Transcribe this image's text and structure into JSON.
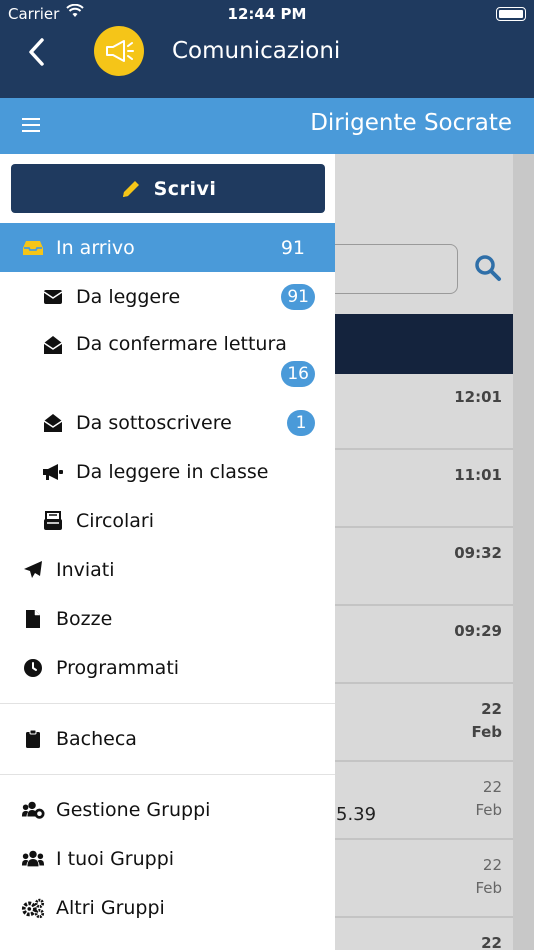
{
  "status_bar": {
    "carrier": "Carrier",
    "time": "12:44 PM"
  },
  "header": {
    "title": "Comunicazioni",
    "user": "Dirigente Socrate"
  },
  "colors": {
    "primary": "#1f3a5f",
    "accent": "#4a9ad9",
    "brand_icon": "#f5c518"
  },
  "drawer": {
    "compose_label": "Scrivi",
    "inbox": {
      "label": "In arrivo",
      "count": "91"
    },
    "inbox_sub": {
      "to_read": {
        "label": "Da leggere",
        "badge": "91"
      },
      "to_confirm": {
        "label": "Da confermare lettura",
        "badge": "16"
      },
      "to_sign": {
        "label": "Da sottoscrivere",
        "badge": "1"
      },
      "read_in_class": {
        "label": "Da leggere in classe"
      },
      "circulars": {
        "label": "Circolari"
      }
    },
    "sent": {
      "label": "Inviati"
    },
    "drafts": {
      "label": "Bozze"
    },
    "scheduled": {
      "label": "Programmati"
    },
    "board": {
      "label": "Bacheca"
    },
    "groups_manage": {
      "label": "Gestione Gruppi"
    },
    "my_groups": {
      "label": "I tuoi Gruppi"
    },
    "other_groups": {
      "label": "Altri Gruppi"
    }
  },
  "background_list": {
    "times": [
      "12:01",
      "11:01",
      "09:32",
      "09:29"
    ],
    "dates": [
      {
        "day": "22",
        "month": "Feb"
      },
      {
        "day": "22",
        "month": "Feb"
      },
      {
        "day": "22",
        "month": "Feb"
      },
      {
        "day": "22",
        "month": ""
      }
    ],
    "row_snippet": "5.39"
  }
}
